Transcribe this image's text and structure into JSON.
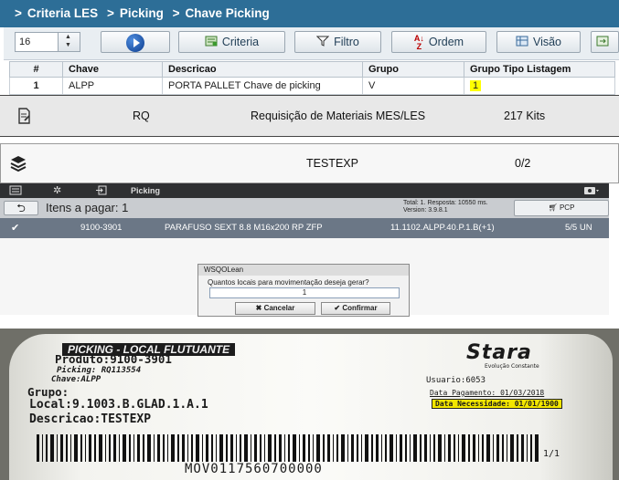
{
  "criteria": {
    "breadcrumb": [
      "Criteria LES",
      "Picking",
      "Chave Picking"
    ],
    "spinner_value": "16",
    "buttons": {
      "criteria": "Criteria",
      "filtro": "Filtro",
      "ordem": "Ordem",
      "visao": "Visão"
    },
    "columns": [
      "#",
      "Chave",
      "Descricao",
      "Grupo",
      "Grupo Tipo Listagem"
    ],
    "rows": [
      [
        "1",
        "ALPP",
        "PORTA PALLET Chave de picking",
        "V",
        "1"
      ]
    ]
  },
  "rq_row": {
    "icon": "document-edit-icon",
    "code": "RQ",
    "description": "Requisição de Materiais MES/LES",
    "count": "217 Kits"
  },
  "testexp_row": {
    "icon": "layers-icon",
    "name": "TESTEXP",
    "progress": "0/2"
  },
  "mobile": {
    "topbar_title": "Picking",
    "header_title": "Itens a pagar: 1",
    "stats_line1": "Total: 1. Resposta: 10550 ms.",
    "stats_line2": "Version: 3.9.8.1",
    "pcp_label": "PCP",
    "item": {
      "code": "9100-3901",
      "description": "PARAFUSO SEXT 8.8 M16x200 RP ZFP",
      "location": "11.1102.ALPP.40.P.1.B(+1)",
      "qty": "5/5 UN"
    },
    "dialog": {
      "title": "WSQOLean",
      "question": "Quantos locais para movimentação deseja gerar?",
      "value": "1",
      "cancel": "Cancelar",
      "confirm": "Confirmar"
    }
  },
  "label": {
    "banner": "PICKING - LOCAL FLUTUANTE",
    "brand": "Stara",
    "brand_tagline": "Evolução Constante",
    "produto": "Produto:9100-3901",
    "picking": "Picking: RQ113554",
    "chave": "Chave:ALPP",
    "usuario": "Usuario:6053",
    "grupo": "Grupo:",
    "data_pagamento": "Data Pagamento: 01/03/2018",
    "local": "Local:9.1003.B.GLAD.1.A.1",
    "data_necessidade": "Data Necessidade: 01/01/1900",
    "descricao": "Descricao:TESTEXP",
    "page": "1/1",
    "barcode_text": "MOV0117560700000"
  }
}
